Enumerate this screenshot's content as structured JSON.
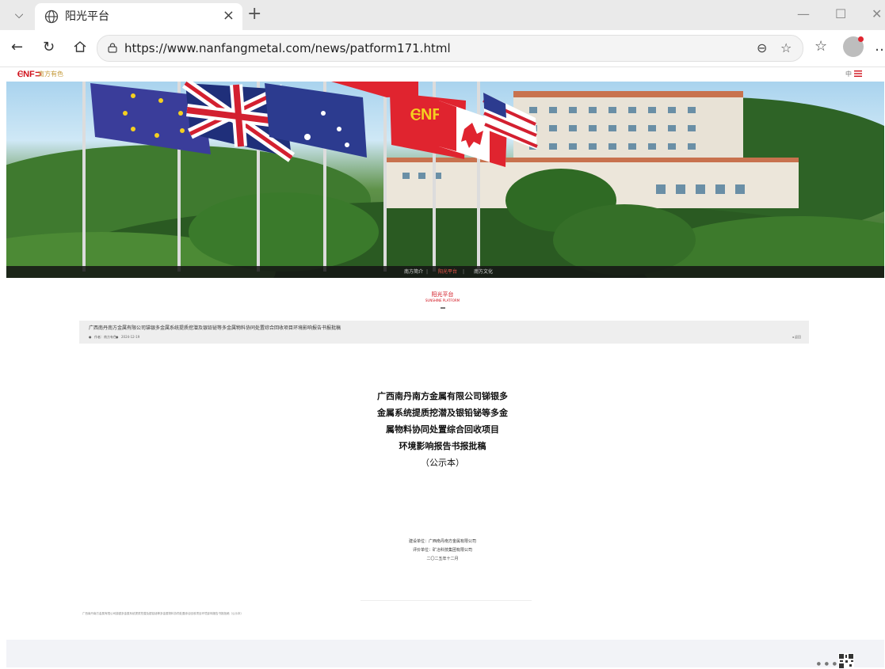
{
  "browser": {
    "tab_title": "阳光平台",
    "tab_close": "×",
    "new_tab": "+",
    "url": "https://www.nanfangmetal.com/news/patform171.html",
    "minimize": "—",
    "maximize": "☐",
    "close_window": "✕"
  },
  "site": {
    "logo_mark": "ⲈNF⊃",
    "logo_cn": "南方有色",
    "lang": "中",
    "banner_nav": [
      "南方简介",
      "阳光平台",
      "南方文化"
    ],
    "banner_nav_active": 1,
    "section_title": "阳光平台",
    "section_subtitle": "SUNSHINE PLATFORM"
  },
  "article": {
    "title": "广西南丹南方金属有限公司锑银多金属系统提质挖潜及银铅铋等多金属物料协同处置综合回收项目环境影响报告书报批稿",
    "author": "作者：南方有色",
    "date": "2024-12-19",
    "back": "◂ 返回"
  },
  "document": {
    "title_lines": [
      "广西南丹南方金属有限公司锑银多",
      "金属系统提质挖潜及银铅铋等多金",
      "属物料协同处置综合回收项目",
      "环境影响报告书报批稿",
      "（公示本）"
    ],
    "info_lines": [
      "建设单位：广西南丹南方金属有限公司",
      "评价单位：矿冶科技集团有限公司",
      "二〇二五年十二月"
    ],
    "footnote": "广西南丹南方金属有限公司锑银多金属系统提质挖潜及银铅铋等多金属物料协同处置综合回收项目环境影响报告书报批稿（公示本）"
  },
  "colors": {
    "brand_red": "#d0101b",
    "gold": "#c59a3a"
  }
}
